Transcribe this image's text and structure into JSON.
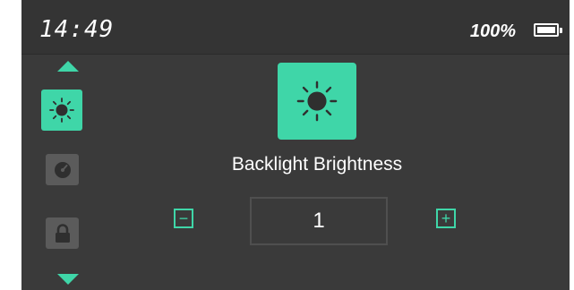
{
  "status": {
    "time": "14:49",
    "battery_percent": "100%",
    "battery_level": 1.0
  },
  "sidebar": {
    "items": [
      {
        "name": "brightness",
        "icon": "sun-icon",
        "active": true
      },
      {
        "name": "gauge",
        "icon": "gauge-icon",
        "active": false
      },
      {
        "name": "lock",
        "icon": "lock-icon",
        "active": false
      }
    ]
  },
  "main": {
    "icon": "sun-icon",
    "title": "Backlight Brightness",
    "value": "1",
    "decrement_symbol": "−",
    "increment_symbol": "+"
  },
  "colors": {
    "accent": "#3fd6a8",
    "background": "#3a3a3a",
    "statusbar": "#343434",
    "inactive_button": "#5b5b5b"
  }
}
